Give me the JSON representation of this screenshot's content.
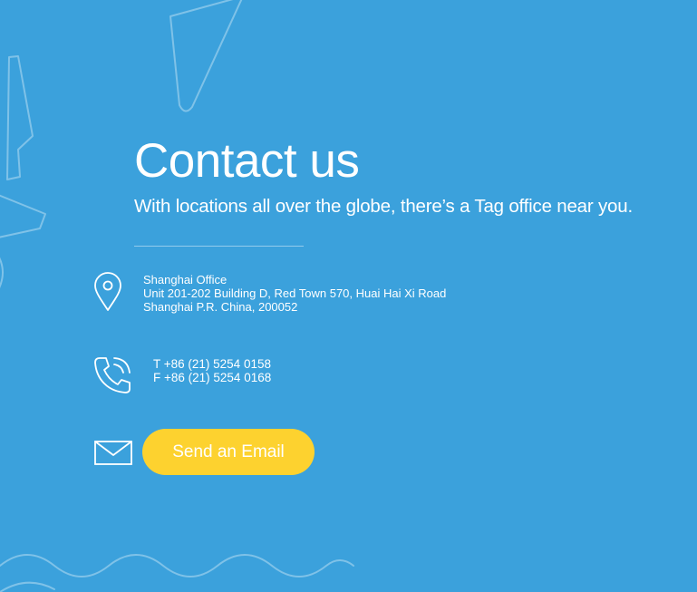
{
  "page": {
    "heading": "Contact us",
    "subheading": "With locations all over the globe, there’s a Tag office near you."
  },
  "office": {
    "icon": "location-pin-icon",
    "name": "Shanghai Office",
    "address_line1": "Unit 201-202 Building D, Red Town 570, Huai Hai Xi Road",
    "address_line2": "Shanghai P.R. China, 200052"
  },
  "phone": {
    "icon": "phone-icon",
    "telephone": "T +86 (21) 5254 0158",
    "fax": "F +86 (21) 5254 0168"
  },
  "email": {
    "icon": "envelope-icon",
    "button_label": "Send an Email"
  },
  "colors": {
    "background": "#3ba1dc",
    "button": "#fdd22f",
    "text": "#ffffff"
  }
}
